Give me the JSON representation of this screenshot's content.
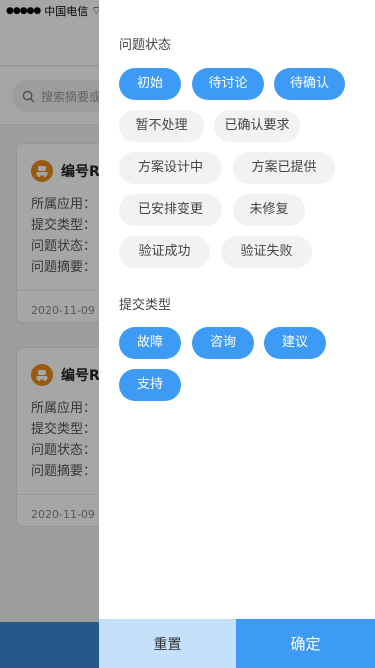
{
  "statusbar": {
    "signal": "●●●●●",
    "carrier": "中国电信",
    "wifi": "⌔"
  },
  "search": {
    "placeholder": "搜索摘要或"
  },
  "cards": [
    {
      "title": "编号R",
      "fields": [
        "所属应用：",
        "提交类型：",
        "问题状态：",
        "问题摘要："
      ],
      "date": "2020-11-09"
    },
    {
      "title": "编号R",
      "fields": [
        "所属应用：",
        "提交类型：",
        "问题状态：",
        "问题摘要："
      ],
      "date": "2020-11-09"
    }
  ],
  "filter": {
    "status_title": "问题状态",
    "status_options": [
      {
        "label": "初始",
        "active": true
      },
      {
        "label": "待讨论",
        "active": true
      },
      {
        "label": "待确认",
        "active": true
      },
      {
        "label": "暂不处理",
        "active": false
      },
      {
        "label": "已确认要求",
        "active": false
      },
      {
        "label": "方案设计中",
        "active": false
      },
      {
        "label": "方案已提供",
        "active": false
      },
      {
        "label": "已安排变更",
        "active": false
      },
      {
        "label": "未修复",
        "active": false
      },
      {
        "label": "验证成功",
        "active": false
      },
      {
        "label": "验证失败",
        "active": false
      }
    ],
    "type_title": "提交类型",
    "type_options": [
      {
        "label": "故障",
        "active": true
      },
      {
        "label": "咨询",
        "active": true
      },
      {
        "label": "建议",
        "active": true
      },
      {
        "label": "支持",
        "active": true
      }
    ],
    "reset_label": "重置",
    "confirm_label": "确定"
  },
  "colors": {
    "accent": "#3d9bf5",
    "reset_bg": "#c4e0fa",
    "chip_inactive": "#f1f2f4",
    "avatar": "#e88a1a"
  }
}
